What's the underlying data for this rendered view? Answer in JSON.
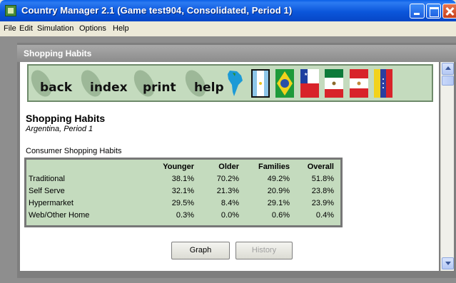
{
  "window": {
    "title": "Country Manager 2.1 (Game test904, Consolidated, Period 1)"
  },
  "menu": {
    "items": [
      "File",
      "Edit",
      "Simulation",
      "Options",
      "Help"
    ]
  },
  "child_window": {
    "title": "Shopping Habits"
  },
  "nav": {
    "back": "back",
    "index": "index",
    "print": "print",
    "help": "help"
  },
  "flags": [
    "south-america-map",
    "argentina-flag",
    "brazil-flag",
    "chile-flag",
    "mexico-flag",
    "peru-flag",
    "venezuela-flag"
  ],
  "page": {
    "heading": "Shopping Habits",
    "subheading": "Argentina, Period 1",
    "section": "Consumer Shopping Habits"
  },
  "table": {
    "columns": [
      "Younger",
      "Older",
      "Families",
      "Overall"
    ],
    "rows": [
      {
        "label": "Traditional",
        "values": [
          "38.1%",
          "70.2%",
          "49.2%",
          "51.8%"
        ]
      },
      {
        "label": "Self Serve",
        "values": [
          "32.1%",
          "21.3%",
          "20.9%",
          "23.8%"
        ]
      },
      {
        "label": "Hypermarket",
        "values": [
          "29.5%",
          "8.4%",
          "29.1%",
          "23.9%"
        ]
      },
      {
        "label": "Web/Other Home",
        "values": [
          "0.3%",
          "0.0%",
          "0.6%",
          "0.4%"
        ]
      }
    ]
  },
  "buttons": {
    "graph": "Graph",
    "history": "History"
  },
  "colors": {
    "panel_green": "#C4DBBE",
    "title_blue": "#0B56DB"
  }
}
